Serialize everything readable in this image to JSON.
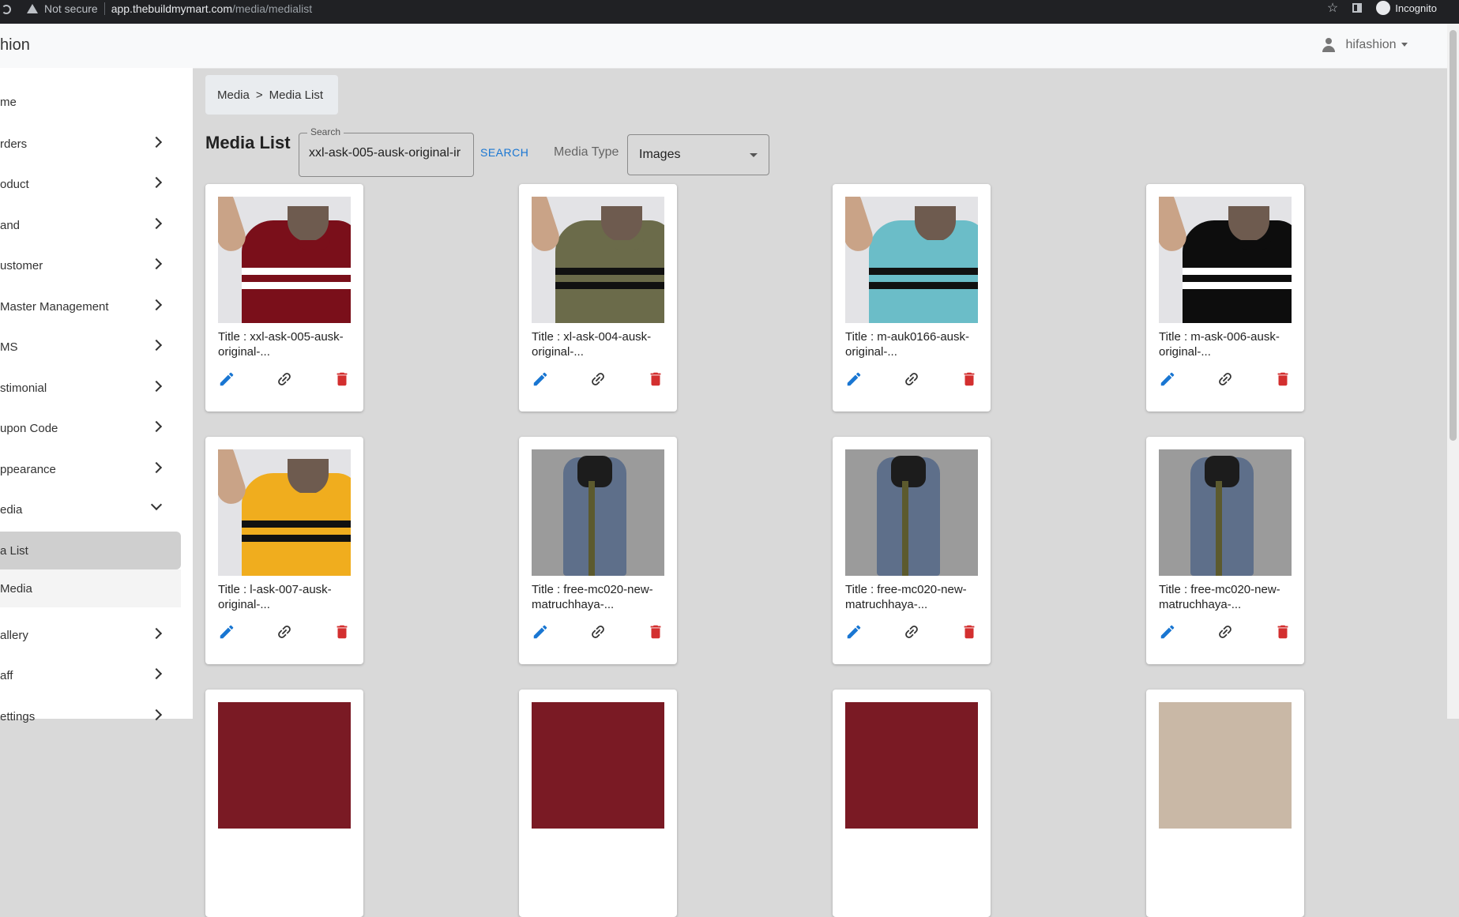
{
  "browser": {
    "security": "Not secure",
    "host": "app.thebuildmymart.com",
    "path": "/media/medialist",
    "incognito": "Incognito"
  },
  "header": {
    "brand": "hion",
    "user": "hifashion"
  },
  "sidebar": {
    "items": [
      {
        "label": "me"
      },
      {
        "label": "rders"
      },
      {
        "label": "oduct"
      },
      {
        "label": "and"
      },
      {
        "label": "ustomer"
      },
      {
        "label": "Master Management"
      },
      {
        "label": "MS"
      },
      {
        "label": "stimonial"
      },
      {
        "label": "upon Code"
      },
      {
        "label": "ppearance"
      },
      {
        "label": "edia"
      }
    ],
    "subitems": [
      {
        "label": "a List"
      },
      {
        "label": "Media"
      }
    ],
    "after": [
      {
        "label": "allery"
      },
      {
        "label": "aff"
      },
      {
        "label": "ettings"
      }
    ]
  },
  "breadcrumb": {
    "root": "Media",
    "sep": ">",
    "current": "Media List"
  },
  "page": {
    "title": "Media List",
    "search_label": "Search",
    "search_value": "xxl-ask-005-ausk-original-ir",
    "search_button": "SEARCH",
    "media_type_label": "Media Type",
    "media_type_value": "Images"
  },
  "cards": [
    {
      "title": "Title : xxl-ask-005-ausk-original-...",
      "image": "tshirt-maroon"
    },
    {
      "title": "Title : xl-ask-004-ausk-original-...",
      "image": "tshirt-olive"
    },
    {
      "title": "Title : m-auk0166-ausk-original-...",
      "image": "tshirt-skyblue"
    },
    {
      "title": "Title : m-ask-006-ausk-original-...",
      "image": "tshirt-black"
    },
    {
      "title": "Title : l-ask-007-ausk-original-...",
      "image": "tshirt-yellow"
    },
    {
      "title": "Title : free-mc020-new-matruchhaya-...",
      "image": "saree-grey"
    },
    {
      "title": "Title : free-mc020-new-matruchhaya-...",
      "image": "saree-grey"
    },
    {
      "title": "Title : free-mc020-new-matruchhaya-...",
      "image": "saree-grey"
    }
  ],
  "colors": {
    "edit": "#1976d2",
    "delete": "#d32f2f",
    "link": "#333333",
    "tshirt-maroon": "#7a0f1a",
    "tshirt-olive": "#6b6b4a",
    "tshirt-skyblue": "#6bbdc8",
    "tshirt-black": "#0d0d0d",
    "tshirt-yellow": "#f0ad1e",
    "saree-grey": "#5e6f8a"
  },
  "icons": {
    "edit": "pencil-icon",
    "link": "link-icon",
    "delete": "trash-icon"
  }
}
